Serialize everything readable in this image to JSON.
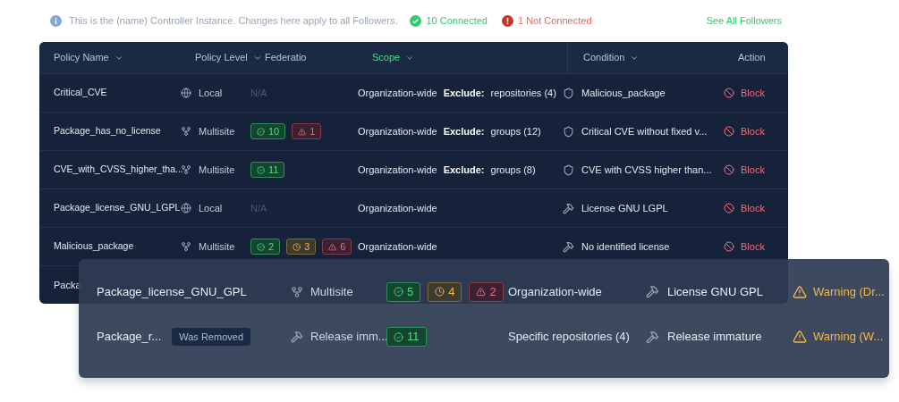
{
  "info_bar": {
    "message": "This is the (name) Controller Instance. Changes here apply to all Followers.",
    "connected": "10 Connected",
    "not_connected": "1 Not Connected",
    "link": "See All Followers"
  },
  "table": {
    "columns": [
      {
        "label": "Policy Name",
        "sortable": true,
        "active": false
      },
      {
        "label": "Policy Level",
        "sortable": true,
        "active": false
      },
      {
        "label": "Federatio",
        "sortable": false,
        "active": false
      },
      {
        "label": "Scope",
        "sortable": true,
        "active": true
      },
      {
        "label": "Condition",
        "sortable": true,
        "active": false
      },
      {
        "label": "Action",
        "sortable": false,
        "active": false
      }
    ],
    "rows": [
      {
        "name": "Critical_CVE",
        "level": {
          "kind": "local",
          "label": "Local"
        },
        "federation": "N/A",
        "badges": [],
        "scope": {
          "text": "Organization-wide",
          "exclude_label": "Exclude:",
          "exclude_value": "repositories (4)"
        },
        "condition": {
          "kind": "shield",
          "label": "Malicious_package"
        },
        "action": {
          "kind": "block",
          "label": "Block"
        }
      },
      {
        "name": "Package_has_no_license",
        "level": {
          "kind": "multisite",
          "label": "Multisite"
        },
        "badges": [
          {
            "kind": "ok",
            "count": "10"
          },
          {
            "kind": "error",
            "count": "1"
          }
        ],
        "scope": {
          "text": "Organization-wide",
          "exclude_label": "Exclude:",
          "exclude_value": "groups (12)"
        },
        "condition": {
          "kind": "shield",
          "label": "Critical CVE without fixed v..."
        },
        "action": {
          "kind": "block",
          "label": "Block"
        }
      },
      {
        "name": "CVE_with_CVSS_higher_tha...",
        "level": {
          "kind": "multisite",
          "label": "Multisite"
        },
        "badges": [
          {
            "kind": "ok",
            "count": "11"
          }
        ],
        "scope": {
          "text": "Organization-wide",
          "exclude_label": "Exclude:",
          "exclude_value": "groups (8)"
        },
        "condition": {
          "kind": "shield",
          "label": "CVE with CVSS higher than..."
        },
        "action": {
          "kind": "block",
          "label": "Block"
        }
      },
      {
        "name": "Package_license_GNU_LGPL",
        "level": {
          "kind": "local",
          "label": "Local"
        },
        "federation": "N/A",
        "badges": [],
        "scope": {
          "text": "Organization-wide"
        },
        "condition": {
          "kind": "rule",
          "label": "License GNU LGPL"
        },
        "action": {
          "kind": "block",
          "label": "Block"
        }
      },
      {
        "name": "Malicious_package",
        "level": {
          "kind": "multisite",
          "label": "Multisite"
        },
        "badges": [
          {
            "kind": "ok",
            "count": "2"
          },
          {
            "kind": "pending",
            "count": "3"
          },
          {
            "kind": "error",
            "count": "6"
          }
        ],
        "scope": {
          "text": "Organization-wide"
        },
        "condition": {
          "kind": "rule",
          "label": "No identified license"
        },
        "action": {
          "kind": "block",
          "label": "Block"
        }
      }
    ],
    "covered_row": {
      "name": "Packa"
    }
  },
  "overlay_rows": [
    {
      "name": "Package_license_GNU_GPL",
      "level": {
        "kind": "multisite",
        "label": "Multisite"
      },
      "badges": [
        {
          "kind": "ok",
          "count": "5"
        },
        {
          "kind": "pending",
          "count": "4"
        },
        {
          "kind": "error",
          "count": "2"
        }
      ],
      "scope": {
        "text": "Organization-wide"
      },
      "condition": {
        "kind": "rule",
        "label": "License GNU GPL"
      },
      "action": {
        "kind": "warning",
        "label": "Warning (Dr..."
      }
    },
    {
      "name": "Package_r...",
      "tag": "Was Removed",
      "level": {
        "kind": "rule",
        "label": "Release imm..."
      },
      "badges": [
        {
          "kind": "ok",
          "count": "11"
        }
      ],
      "scope": {
        "text": "Specific repositories (4)"
      },
      "condition": {
        "kind": "rule",
        "label": "Release immature"
      },
      "action": {
        "kind": "warning",
        "label": "Warning (W..."
      }
    }
  ]
}
